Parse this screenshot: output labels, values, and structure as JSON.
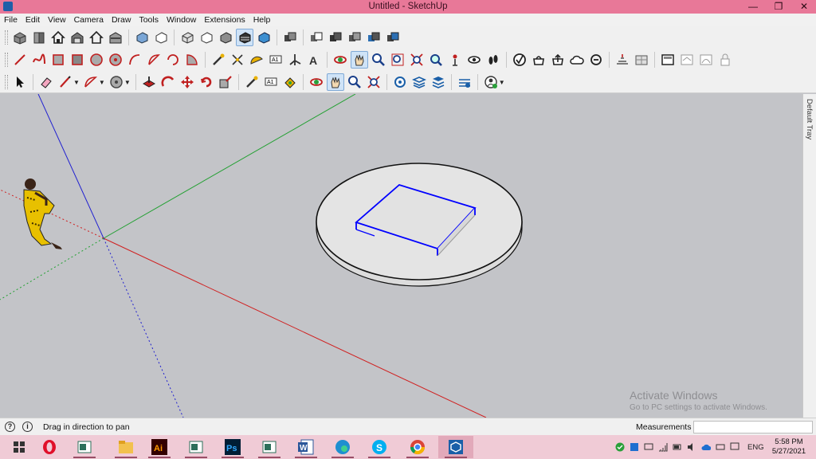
{
  "window": {
    "title": "Untitled - SketchUp",
    "controls": [
      "minimize",
      "maximize",
      "close"
    ]
  },
  "menu": [
    "File",
    "Edit",
    "View",
    "Camera",
    "Draw",
    "Tools",
    "Window",
    "Extensions",
    "Help"
  ],
  "toolbars": {
    "row1": [
      "iso-view-icon",
      "top-view-icon",
      "front-view-icon",
      "right-view-icon",
      "back-view-icon",
      "left-view-icon",
      "xray-style-icon",
      "wireframe-style-icon",
      "hidden-line-style-icon",
      "shaded-style-icon",
      "shaded-textures-style-icon",
      "monochrome-style-icon",
      "union-icon",
      "subtract-icon",
      "trim-icon",
      "intersect-icon",
      "split-icon"
    ],
    "row2": [
      "line-icon",
      "freehand-icon",
      "rectangle-icon",
      "rotated-rectangle-icon",
      "circle-icon",
      "polygon-icon",
      "arc-icon",
      "two-point-arc-icon",
      "three-point-arc-icon",
      "pie-icon",
      "tape-measure-icon",
      "dimension-icon",
      "protractor-icon",
      "text-icon",
      "axes-icon",
      "3d-text-icon",
      "orbit-icon",
      "pan-icon",
      "zoom-icon",
      "zoom-window-icon",
      "zoom-extents-icon",
      "previous-view-icon",
      "position-camera-icon",
      "look-around-icon",
      "walk-icon",
      "solid-tools-icon",
      "warehouse-icon",
      "share-model-icon",
      "cloud-icon",
      "dynamic-components-icon",
      "sandbox-from-contours-icon",
      "sandbox-from-scratch-icon",
      "section-plane-icon",
      "section-display-icon",
      "section-cut-icon",
      "lock-icon"
    ],
    "row3": [
      "select-icon",
      "eraser-icon",
      "paint-bucket-icon",
      "arc-dropdown-icon",
      "circle-dropdown-icon",
      "push-pull-icon",
      "follow-me-icon",
      "move-icon",
      "rotate-icon",
      "scale-icon",
      "offset-icon",
      "tape-measure-icon",
      "text-icon",
      "paint-icon",
      "orbit-icon",
      "pan-icon",
      "zoom-icon",
      "zoom-extents-icon",
      "components-icon",
      "layers-icon",
      "outliner-icon",
      "entity-info-icon",
      "account-icon"
    ]
  },
  "default_tray_label": "Default Tray",
  "status": {
    "hint": "Drag in direction to pan",
    "measurements_label": "Measurements",
    "measurements_value": ""
  },
  "watermark": {
    "line1": "Activate Windows",
    "line2": "Go to PC settings to activate Windows."
  },
  "taskbar": {
    "apps": [
      "windows-start-icon",
      "opera-icon",
      "image-viewer-icon",
      "file-explorer-icon",
      "illustrator-icon",
      "image-viewer-icon",
      "image-viewer-icon",
      "photoshop-icon",
      "image-viewer-icon",
      "word-icon",
      "edge-icon",
      "skype-icon",
      "chrome-icon",
      "sketchup-icon"
    ],
    "language": "ENG",
    "time": "5:58 PM",
    "date": "5/27/2021"
  },
  "colors": {
    "title_bar": "#e87898",
    "viewport_bg": "#c3c4c8",
    "red_axis": "#d02020",
    "green_axis": "#22a032",
    "blue_axis": "#2020d0",
    "selection_blue": "#0000ff",
    "taskbar": "#f0cbd6"
  }
}
